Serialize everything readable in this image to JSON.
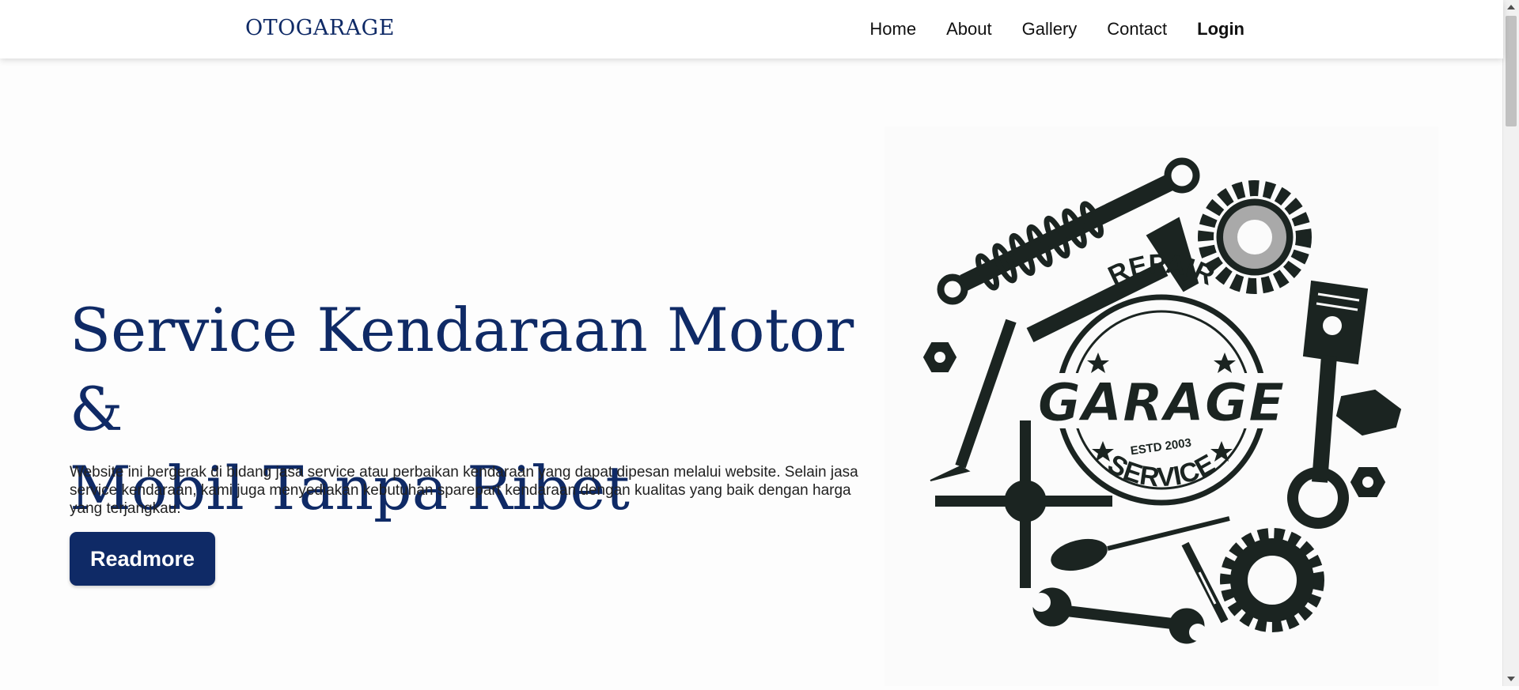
{
  "brand": "OTOGARAGE",
  "nav": {
    "home": "Home",
    "about": "About",
    "gallery": "Gallery",
    "contact": "Contact",
    "login": "Login"
  },
  "hero": {
    "title_line1": "Service Kendaraan Motor &",
    "title_line2": "Mobil Tanpa Ribet",
    "description": "Website ini bergerak di bidang jasa service atau perbaikan kendaraan yang dapat dipesan melalui website. Selain jasa service kendaraan, kami juga menyediakan kebutuhan sparepart kendaraan dengan kualitas yang baik dengan harga yang terjangkau.",
    "button": "Readmore"
  },
  "logo": {
    "top_text": "REPAIR",
    "center_text": "GARAGE",
    "estd_text": "ESTD 2003",
    "bottom_text": "SERVICE"
  },
  "colors": {
    "brand": "#0f2a66",
    "text": "#222222",
    "illustration": "#1b2421"
  }
}
